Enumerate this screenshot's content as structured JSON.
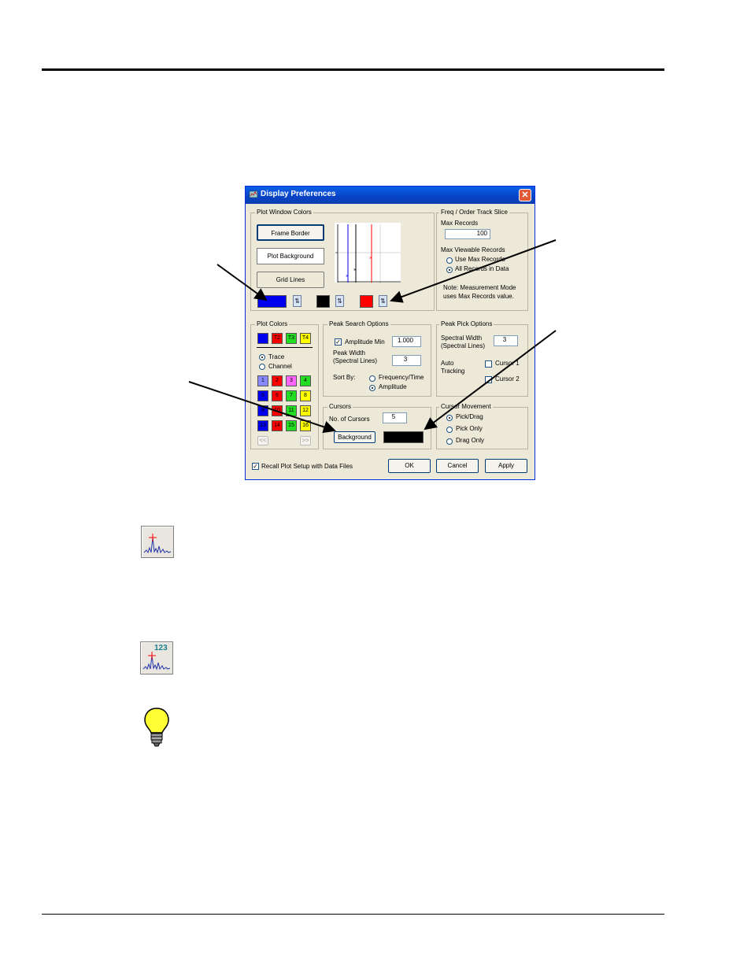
{
  "dialog": {
    "title": "Display Preferences",
    "close_label": "✕",
    "plot_window_colors": {
      "label": "Plot Window Colors",
      "frame_border": "Frame Border",
      "plot_background": "Plot Background",
      "grid_lines": "Grid Lines",
      "cursor_colors": [
        "#0000ee",
        "#000000",
        "#ff0000"
      ],
      "selector_glyph": "⇅"
    },
    "freq_order": {
      "label": "Freq / Order Track Slice",
      "max_records_label": "Max Records",
      "max_records_value": "100",
      "max_viewable_label": "Max Viewable Records",
      "use_max": "Use Max Records",
      "all_records": "All Records in Data",
      "note": "Note: Measurement Mode uses Max Records value."
    },
    "plot_colors": {
      "label": "Plot Colors",
      "top": [
        "",
        "T2",
        "T3",
        "T4"
      ],
      "trace": "Trace",
      "channel": "Channel",
      "grid": [
        "1",
        "2",
        "3",
        "4",
        "5",
        "6",
        "7",
        "8",
        "9",
        "10",
        "11",
        "12",
        "13",
        "14",
        "15",
        "16"
      ],
      "prev": "<<",
      "next": ">>"
    },
    "peak_search": {
      "label": "Peak Search Options",
      "amplitude_min": "Amplitude Min",
      "amplitude_min_value": "1.000",
      "peak_width": "Peak Width (Spectral Lines)",
      "peak_width_value": "3",
      "sort_by": "Sort By:",
      "freq_time": "Frequency/Time",
      "amplitude": "Amplitude"
    },
    "peak_pick": {
      "label": "Peak Pick Options",
      "spectral_width": "Spectral Width (Spectral Lines)",
      "spectral_width_value": "3",
      "auto_tracking": "Auto Tracking",
      "cursor1": "Cursor 1",
      "cursor2": "Cursor 2"
    },
    "cursors": {
      "label": "Cursors",
      "num_label": "No. of Cursors",
      "num_value": "5",
      "background": "Background"
    },
    "cursor_movement": {
      "label": "Cursor Movement",
      "pick_drag": "Pick/Drag",
      "pick_only": "Pick Only",
      "drag_only": "Drag Only"
    },
    "recall": "Recall Plot Setup with Data Files",
    "ok": "OK",
    "cancel": "Cancel",
    "apply": "Apply"
  },
  "icons": {
    "icon2_text": "123"
  }
}
